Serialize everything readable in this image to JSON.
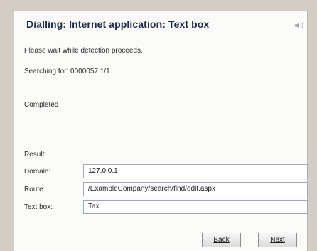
{
  "dialog": {
    "title": "Dialling: Internet application: Text box",
    "message": "Please wait while detection proceeds.",
    "searching": "Searching for: 0000057 1/1",
    "status": "Completed",
    "result_heading": "Result:"
  },
  "fields": [
    {
      "label": "Domain:",
      "value": "127.0.0.1"
    },
    {
      "label": "Route:",
      "value": "/ExampleCompany/search/find/edit.aspx"
    },
    {
      "label": "Text box:",
      "value": "Tax"
    }
  ],
  "buttons": {
    "back_label": "Back",
    "next_label": "Next"
  },
  "icons": {
    "title_icon": "speaker-icon"
  },
  "colors": {
    "title": "#1a2a4a",
    "background": "#d2cec6",
    "panel": "#fbfbf9"
  }
}
